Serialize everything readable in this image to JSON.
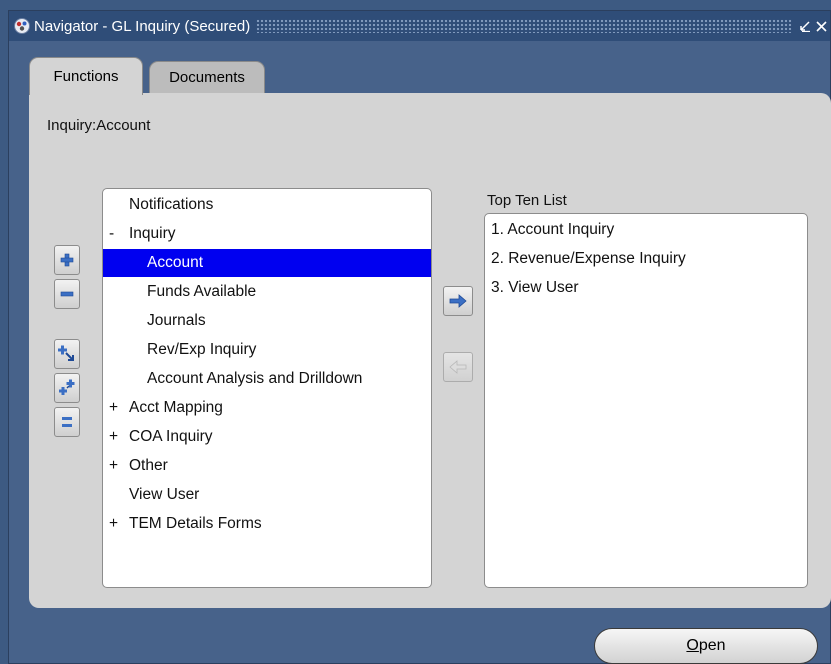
{
  "window": {
    "title": "Navigator - GL Inquiry (Secured)"
  },
  "tabs": [
    {
      "label": "Functions",
      "active": true
    },
    {
      "label": "Documents",
      "active": false
    }
  ],
  "breadcrumb": "Inquiry:Account",
  "tree": [
    {
      "prefix": "",
      "label": "Notifications",
      "level": 0,
      "selected": false
    },
    {
      "prefix": "-",
      "label": "Inquiry",
      "level": 0,
      "selected": false
    },
    {
      "prefix": "",
      "label": "Account",
      "level": 1,
      "selected": true
    },
    {
      "prefix": "",
      "label": "Funds Available",
      "level": 1,
      "selected": false
    },
    {
      "prefix": "",
      "label": "Journals",
      "level": 1,
      "selected": false
    },
    {
      "prefix": "",
      "label": "Rev/Exp Inquiry",
      "level": 1,
      "selected": false
    },
    {
      "prefix": "",
      "label": "Account Analysis and Drilldown",
      "level": 1,
      "selected": false
    },
    {
      "prefix": "+",
      "label": "Acct Mapping",
      "level": 0,
      "selected": false
    },
    {
      "prefix": "+",
      "label": "COA Inquiry",
      "level": 0,
      "selected": false
    },
    {
      "prefix": "+",
      "label": "Other",
      "level": 0,
      "selected": false
    },
    {
      "prefix": "",
      "label": "View User",
      "level": 0,
      "selected": false
    },
    {
      "prefix": "+",
      "label": "TEM Details Forms",
      "level": 0,
      "selected": false
    }
  ],
  "top_ten": {
    "label": "Top Ten List",
    "items": [
      "1. Account Inquiry",
      "2. Revenue/Expense Inquiry",
      "3. View User"
    ]
  },
  "buttons": {
    "open_mnemonic": "O",
    "open_rest": "pen"
  },
  "icons": {
    "expand": "plus-icon",
    "collapse": "minus-icon",
    "expand_branch": "expand-branch-icon",
    "expand_all": "expand-all-icon",
    "collapse_all": "collapse-all-icon",
    "add_to_top_ten": "arrow-right-icon",
    "remove_from_top_ten": "arrow-left-icon",
    "app": "oracle-navigator-icon"
  },
  "colors": {
    "selection": "#0000f0",
    "titlebar": "#2f4d78",
    "panel": "#d4d4d4",
    "icon_blue": "#3b6fc4"
  }
}
